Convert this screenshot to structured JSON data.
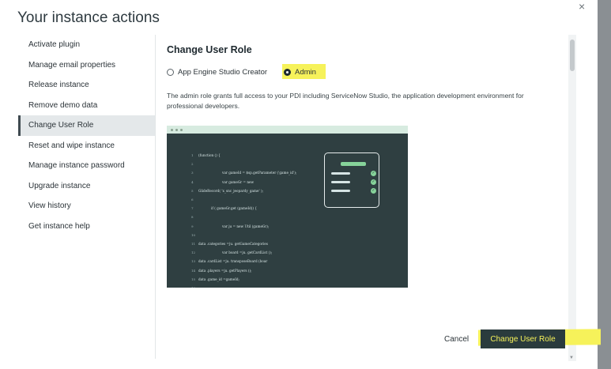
{
  "header": {
    "title": "Your instance actions",
    "close_glyph": "×"
  },
  "sidebar": {
    "items": [
      {
        "label": "Activate plugin"
      },
      {
        "label": "Manage email properties"
      },
      {
        "label": "Release instance"
      },
      {
        "label": "Remove demo data"
      },
      {
        "label": "Change User Role",
        "active": true
      },
      {
        "label": "Reset and wipe instance"
      },
      {
        "label": "Manage instance password"
      },
      {
        "label": "Upgrade instance"
      },
      {
        "label": "View history"
      },
      {
        "label": "Get instance help"
      }
    ]
  },
  "main": {
    "title": "Change User Role",
    "roles": [
      {
        "label": "App Engine Studio Creator",
        "selected": false
      },
      {
        "label": "Admin",
        "selected": true
      }
    ],
    "description": "The admin role grants full access to your PDI including ServiceNow Studio, the application development environment for professional developers."
  },
  "illustration": {
    "code_lines": [
      {
        "ln": "1",
        "text": "(function    () {"
      },
      {
        "ln": "2",
        "text": ""
      },
      {
        "ln": "3",
        "text": "var gameId    = $sp.getParameter    ('game_id');"
      },
      {
        "ln": "4",
        "text": "var gameGr    = new"
      },
      {
        "ln": "5",
        "text": "GlideRecord(      'x_snc_jeopardy_game'       );"
      },
      {
        "ln": "6",
        "text": ""
      },
      {
        "ln": "7",
        "text": "if (  gameGr.get  (gameId)) {"
      },
      {
        "ln": "8",
        "text": ""
      },
      {
        "ln": "9",
        "text": "var ju      = new Util    (gameGr);"
      },
      {
        "ln": "10",
        "text": ""
      },
      {
        "ln": "11",
        "text": "data               .categories       =ju.   getGameCategories"
      },
      {
        "ln": "12",
        "text": "var board      =ju.   getCardList        ();"
      },
      {
        "ln": "13",
        "text": "data               .cardList        =ju.   transposeBoard       (boar"
      },
      {
        "ln": "14",
        "text": "data               .players       =ju.   getPlayers       ();"
      },
      {
        "ln": "15",
        "text": "data               .game_id      =gameId;"
      },
      {
        "ln": "16",
        "text": ""
      },
      {
        "ln": "17",
        "text": "if (  gameGr.getValue      ('state  ') == '      pendi"
      }
    ]
  },
  "footer": {
    "cancel_label": "Cancel",
    "primary_label": "Change User Role"
  },
  "colors": {
    "highlight": "#f6f25a",
    "primary_button_bg": "#2a3b3d",
    "illustration_bg": "#2f3f41",
    "accent_green": "#86d39a"
  }
}
